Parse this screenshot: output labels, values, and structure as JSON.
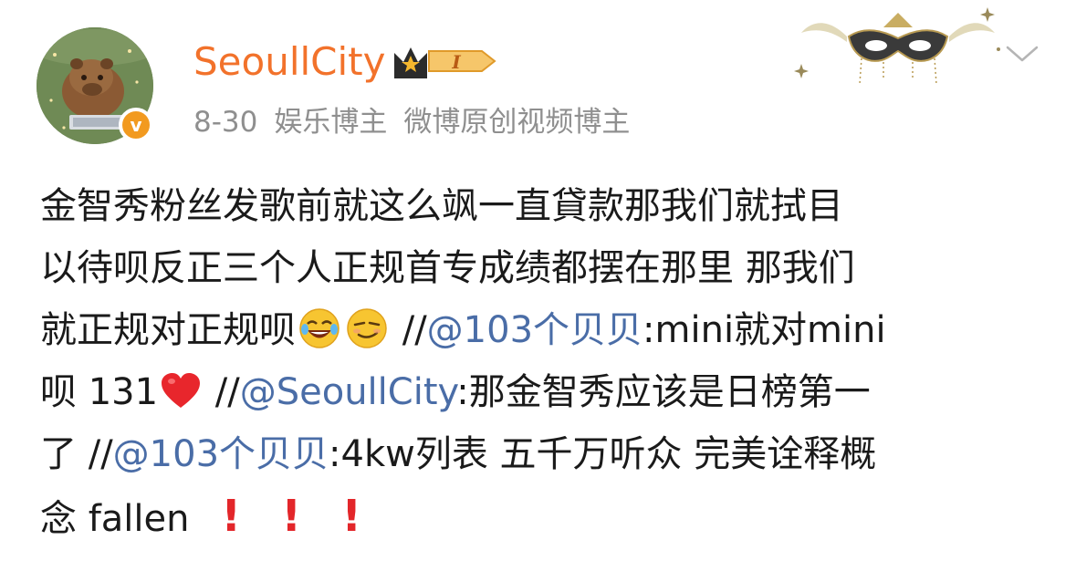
{
  "header": {
    "username": "SeoullCity",
    "vip_level": "I",
    "date": "8-30",
    "tags": [
      "娱乐博主",
      "微博原创视频博主"
    ],
    "avatar_icon": "capybara-avatar",
    "verified_icon": "verified-v-icon",
    "verified_letter": "v",
    "decoration_icon": "masquerade-mask-decoration",
    "menu_icon": "chevron-down-icon"
  },
  "post": {
    "line1": "金智秀粉丝发歌前就这么飒一直貸款那我们就拭目",
    "line2": "以待呗反正三个人正规首专成绩都摆在那里 那我们",
    "line3_text": "就正规对正规呗",
    "line3_sep": " //",
    "mention1": "@103个贝贝",
    "line3_tail": ":mini就对mini",
    "line4_head": "呗 131",
    "line4_sep": " //",
    "mention2": "@SeoullCity",
    "line4_tail": ":那金智秀应该是日榜第一",
    "line5_head": "了 //",
    "mention3": "@103个贝贝",
    "line5_tail": ":4kw列表 五千万听众 完美诠释概",
    "line6_text": "念 fallen",
    "bang": "!",
    "emoji_1": "laughing-tears-emoji",
    "emoji_2": "smug-smile-emoji",
    "heart": "red-heart-emoji"
  },
  "colors": {
    "username": "#f2722b",
    "meta": "#8f8f8f",
    "mention": "#4a6da7",
    "exclamation": "#e3262a",
    "verified": "#f29a1f"
  }
}
